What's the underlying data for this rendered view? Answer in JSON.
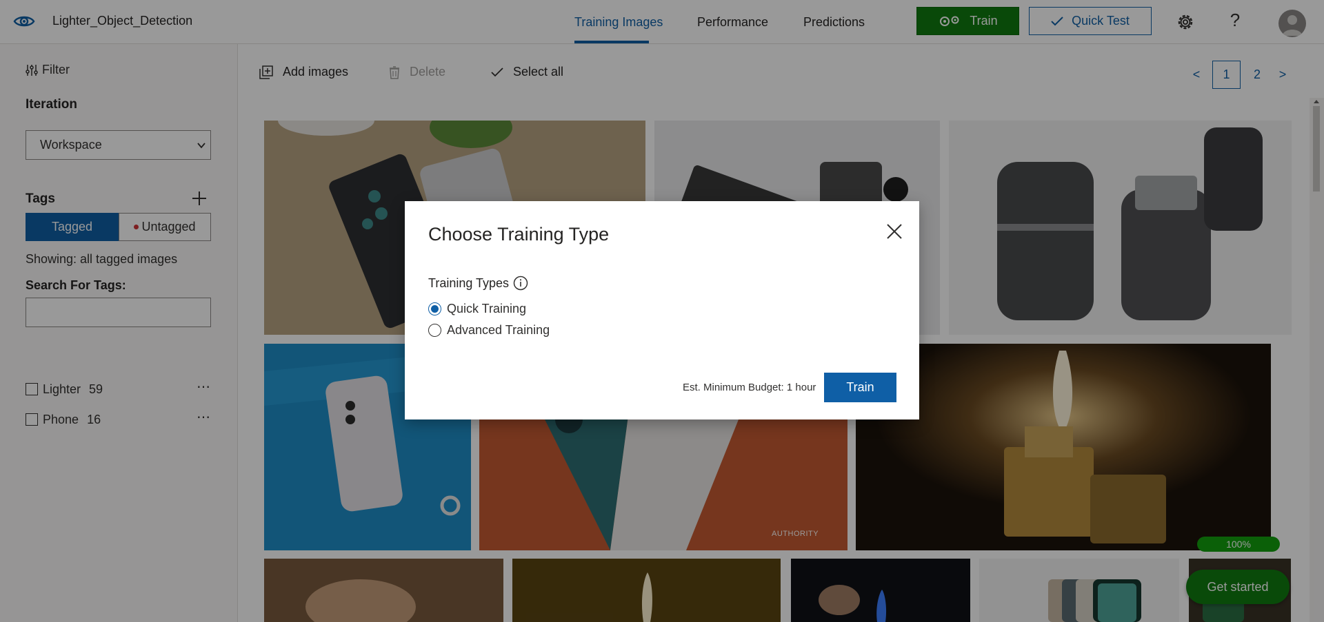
{
  "header": {
    "project_name": "Lighter_Object_Detection",
    "nav": {
      "training_images": "Training Images",
      "performance": "Performance",
      "predictions": "Predictions"
    },
    "train_label": "Train",
    "quick_test_label": "Quick Test",
    "help_label": "?",
    "accent_color": "#0f5fa6",
    "train_color": "#0f7b0f"
  },
  "sidebar": {
    "filter_label": "Filter",
    "iteration_label": "Iteration",
    "iteration_selected": "Workspace",
    "tags_label": "Tags",
    "tab_tagged": "Tagged",
    "tab_untagged": "Untagged",
    "showing_text": "Showing: all tagged images",
    "search_label": "Search For Tags:",
    "search_value": "",
    "tags": [
      {
        "name": "Lighter",
        "count": "59"
      },
      {
        "name": "Phone",
        "count": "16"
      }
    ]
  },
  "toolbar": {
    "add_images": "Add images",
    "delete": "Delete",
    "select_all": "Select all"
  },
  "pagination": {
    "prev": "<",
    "pages": [
      "1",
      "2"
    ],
    "current": "1",
    "next": ">"
  },
  "gallery": {
    "watermark": "AUTHORITY",
    "progress": "100%"
  },
  "get_started_label": "Get started",
  "dialog": {
    "title": "Choose Training Type",
    "types_label": "Training Types",
    "options": [
      "Quick Training",
      "Advanced Training"
    ],
    "selected": "Quick Training",
    "budget_text": "Est. Minimum Budget: 1 hour",
    "train_label": "Train"
  }
}
